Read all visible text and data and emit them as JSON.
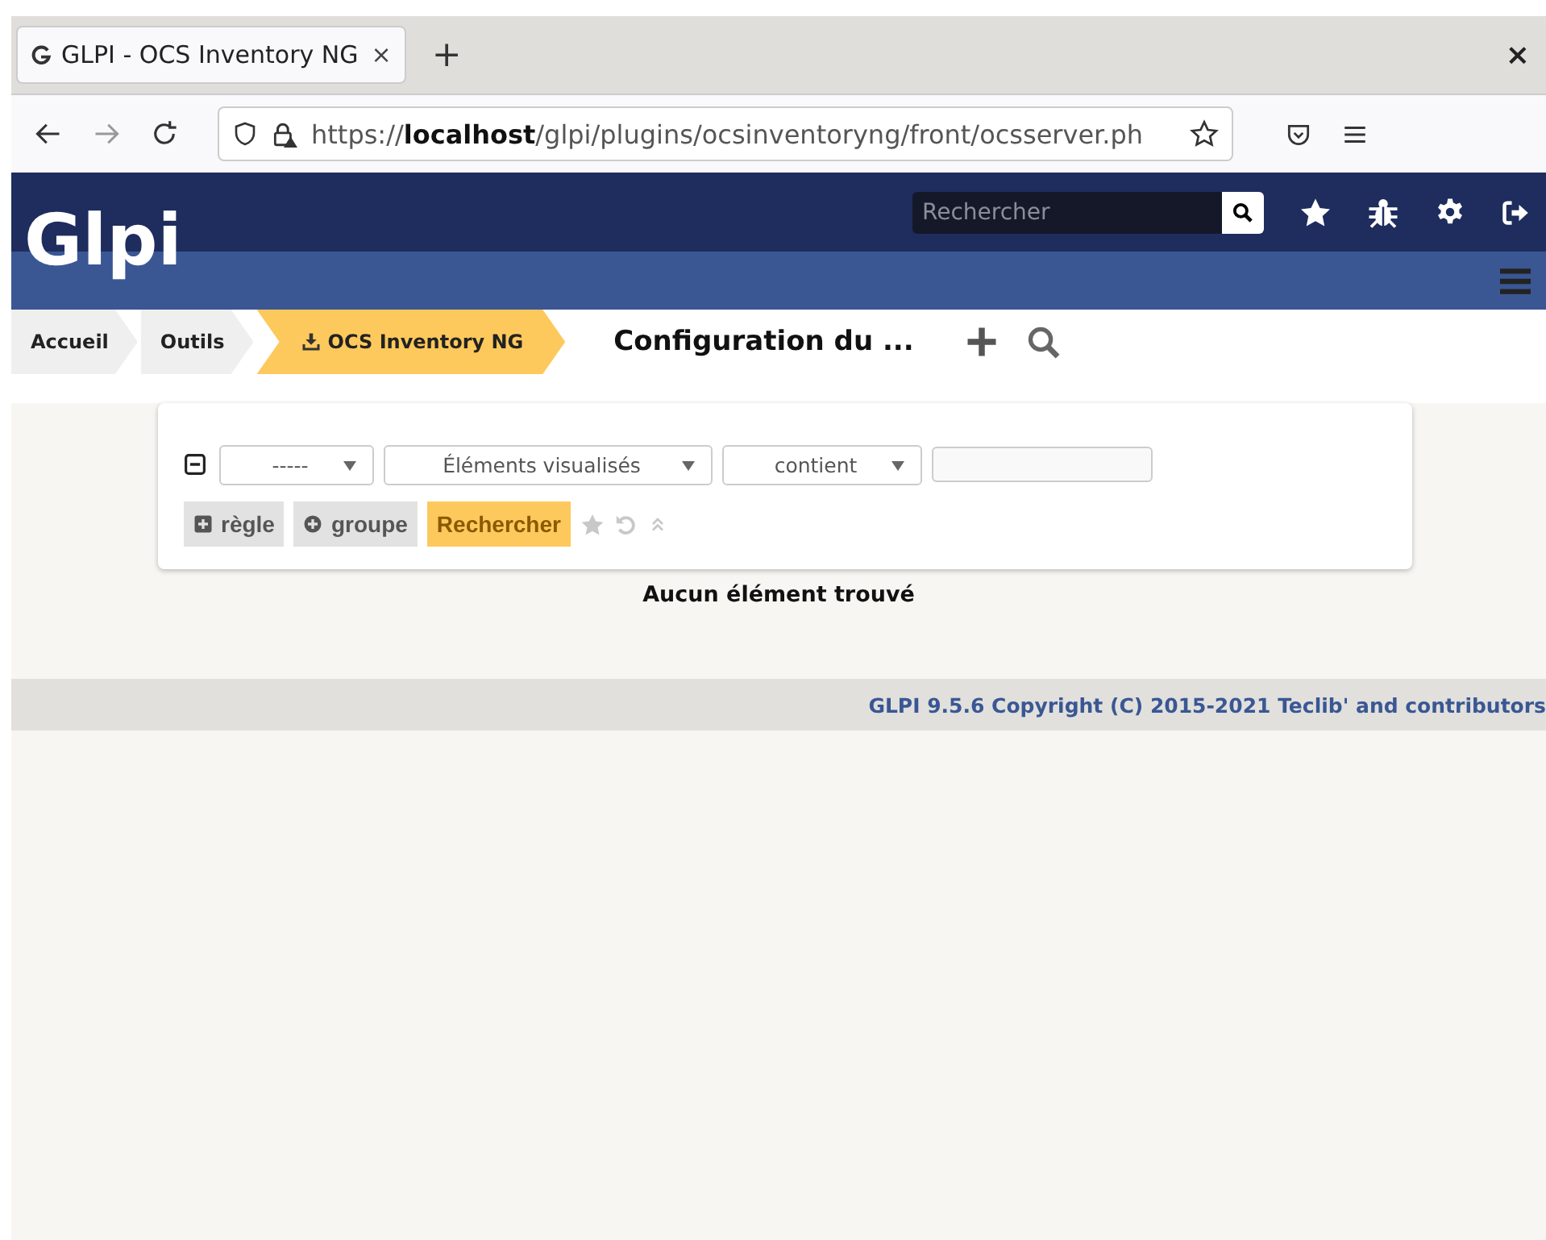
{
  "browser": {
    "tab": {
      "title": "GLPI - OCS Inventory NG",
      "close": "×"
    },
    "new_tab": "+",
    "window_close": "×",
    "url": "https://**localhost**/glpi/plugins/ocsinventoryng/front/ocsserver.ph"
  },
  "header": {
    "logo": "Glpi",
    "search": {
      "placeholder": "Rechercher"
    }
  },
  "breadcrumb": [
    {
      "label": "Accueil",
      "selected": false,
      "icon": false
    },
    {
      "label": "Outils",
      "selected": false,
      "icon": false
    },
    {
      "label": "OCS Inventory NG",
      "selected": true,
      "icon": true
    }
  ],
  "page_title": "Configuration du ...",
  "search_form": {
    "criteria": [
      {
        "value": "-----"
      },
      {
        "value": "Éléments visualisés"
      },
      {
        "value": "contient"
      }
    ],
    "buttons": [
      {
        "kind": "rule",
        "label": "règle"
      },
      {
        "kind": "group",
        "label": "groupe"
      },
      {
        "kind": "search",
        "label": "Rechercher"
      }
    ]
  },
  "message": "Aucun élément trouvé",
  "footer": "GLPI 9.5.6 Copyright (C) 2015-2021 Teclib' and contributors"
}
